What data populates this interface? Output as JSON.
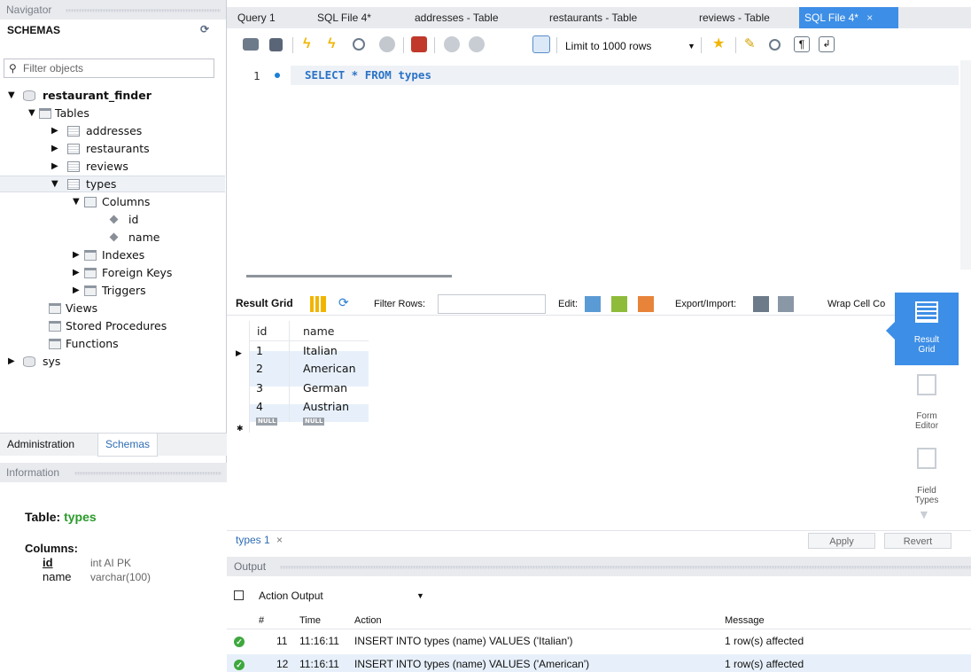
{
  "navigator": {
    "title": "Navigator",
    "schemas_label": "SCHEMAS",
    "filter_placeholder": "Filter objects",
    "tree": {
      "db": "restaurant_finder",
      "tables_label": "Tables",
      "tables": [
        "addresses",
        "restaurants",
        "reviews",
        "types"
      ],
      "columns_label": "Columns",
      "columns": [
        "id",
        "name"
      ],
      "indexes_label": "Indexes",
      "foreign_keys_label": "Foreign Keys",
      "triggers_label": "Triggers",
      "views_label": "Views",
      "procedures_label": "Stored Procedures",
      "functions_label": "Functions",
      "sys": "sys"
    },
    "tabs": [
      "Administration",
      "Schemas"
    ]
  },
  "information": {
    "title": "Information",
    "table_label": "Table:",
    "table_name": "types",
    "columns_label": "Columns:",
    "columns": [
      {
        "name": "id",
        "type": "int AI PK"
      },
      {
        "name": "name",
        "type": "varchar(100)"
      }
    ]
  },
  "editor_tabs": [
    "Query 1",
    "SQL File 4*",
    "addresses - Table",
    "restaurants - Table",
    "reviews - Table",
    "SQL File 4*"
  ],
  "close_glyph": "×",
  "toolbar": {
    "limit_label": "Limit to 1000 rows"
  },
  "editor": {
    "line_number": "1",
    "sql": "SELECT * FROM types"
  },
  "result_toolbar": {
    "result_grid": "Result Grid",
    "filter_rows": "Filter Rows:",
    "edit": "Edit:",
    "export_import": "Export/Import:",
    "wrap": "Wrap Cell Co"
  },
  "grid": {
    "headers": [
      "id",
      "name"
    ],
    "rows": [
      [
        "1",
        "Italian"
      ],
      [
        "2",
        "American"
      ],
      [
        "3",
        "German"
      ],
      [
        "4",
        "Austrian"
      ]
    ],
    "null_label": "NULL"
  },
  "side_panel": {
    "result_grid": [
      "Result",
      "Grid"
    ],
    "form_editor": [
      "Form",
      "Editor"
    ],
    "field_types": [
      "Field",
      "Types"
    ]
  },
  "bottom": {
    "result_tab": "types 1",
    "apply": "Apply",
    "revert": "Revert"
  },
  "output": {
    "title": "Output",
    "selector": "Action Output",
    "headers": [
      "#",
      "Time",
      "Action",
      "Message"
    ],
    "rows": [
      {
        "num": "11",
        "time": "11:16:11",
        "action": "INSERT INTO types (name) VALUES ('Italian')",
        "message": "1 row(s) affected"
      },
      {
        "num": "12",
        "time": "11:16:11",
        "action": "INSERT INTO types (name) VALUES ('American')",
        "message": "1 row(s) affected"
      }
    ]
  }
}
